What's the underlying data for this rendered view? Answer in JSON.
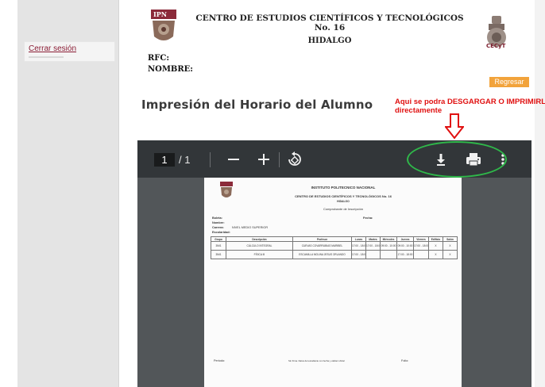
{
  "sidebar": {
    "logout_label": "Cerrar sesión"
  },
  "header": {
    "school_name": "CENTRO DE ESTUDIOS CIENTÍFICOS Y TECNOLÓGICOS No. 16",
    "school_state": "HIDALGO",
    "rfc_label": "RFC:",
    "nombre_label": "NOMBRE:"
  },
  "actions": {
    "regresar_label": "Regresar"
  },
  "page": {
    "title": "Impresión del Horario del Alumno"
  },
  "annotation": {
    "text": "Aqui se podra DESGARGAR O IMPRIMIRLO directamente"
  },
  "viewer": {
    "current_page": "1",
    "total_pages": "/ 1",
    "colors": {
      "toolbar": "#323639",
      "canvas": "#525659",
      "highlight": "#2fb84a",
      "annotation": "#e01010",
      "accent": "#f2a33b"
    },
    "icons": [
      "zoom-out-icon",
      "zoom-in-icon",
      "rotate-icon",
      "download-icon",
      "print-icon",
      "more-options-icon"
    ]
  },
  "document": {
    "institution": "INSTITUTO POLITECNICO NACIONAL",
    "center": "CENTRO DE ESTUDIOS CIENTÍFICOS Y TECNOLÓGICOS No. 16",
    "state": "HIDALGO",
    "doc_title": "Comprobante de Inscripción",
    "labels": {
      "boleta": "Boleta:",
      "nombre": "Nombre:",
      "carrera": "Carrera:",
      "escolaridad": "Escolaridad:",
      "fecha": "Fecha:"
    },
    "carrera_value": "NIVEL MEDIO SUPERIOR",
    "table_headers": [
      "Grupo",
      "Descripción",
      "Profesor",
      "Lunes",
      "Martes",
      "Miércoles",
      "Jueves",
      "Viernes",
      "Edificio",
      "Salón"
    ],
    "rows": [
      [
        "3IM1",
        "CÁLCULO INTEGRAL",
        "CUEVAS COVARRUBIAS MARIBEL",
        "17:00 - 18:00",
        "17:00 - 18:00",
        "09:00 - 10:00",
        "09:00 - 10:00",
        "17:00 - 18:00",
        "X",
        "X"
      ],
      [
        "3IM1",
        "FÍSICA III",
        "ESCAMILLA MOLINA JESUS ORLANDO",
        "17:00 - 18:00",
        "",
        "",
        "17:00 - 18:00",
        "",
        "X",
        "X"
      ]
    ],
    "footer": {
      "periodo": "Periodo:",
      "middle": "Sin firma. Datos del estudiante con fecha y validez oficial",
      "folio": "Folio:"
    }
  }
}
